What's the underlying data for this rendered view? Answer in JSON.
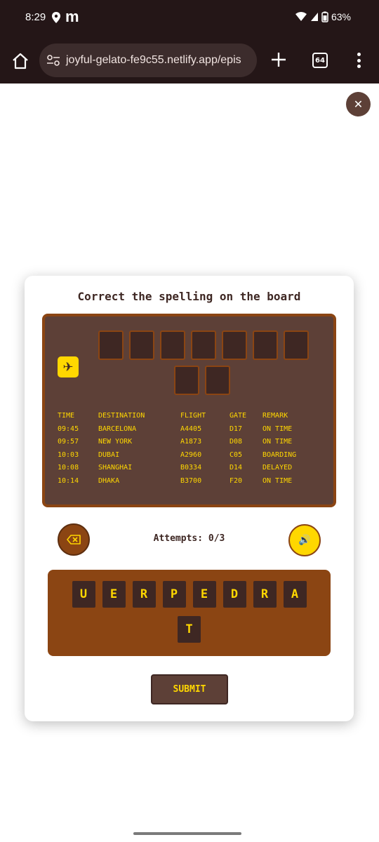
{
  "status_bar": {
    "time": "8:29",
    "battery": "63%"
  },
  "browser": {
    "url": "joyful-gelato-fe9c55.netlify.app/epis",
    "tab_count": "64"
  },
  "close_symbol": "✕",
  "game": {
    "title": "Correct the spelling on the board",
    "plane_symbol": "✈",
    "attempts": "Attempts: 0/3",
    "submit_label": "SUBMIT",
    "sound_symbol": "🔊",
    "answer_slots_row1": 7,
    "answer_slots_row2": 2,
    "flight_board": {
      "headers": [
        "TIME",
        "DESTINATION",
        "FLIGHT",
        "GATE",
        "REMARK"
      ],
      "rows": [
        [
          "09:45",
          "BARCELONA",
          "A4405",
          "D17",
          "ON TIME"
        ],
        [
          "09:57",
          "NEW YORK",
          "A1873",
          "D08",
          "ON TIME"
        ],
        [
          "10:03",
          "DUBAI",
          "A2960",
          "C05",
          "BOARDING"
        ],
        [
          "10:08",
          "SHANGHAI",
          "B0334",
          "D14",
          "DELAYED"
        ],
        [
          "10:14",
          "DHAKA",
          "B3700",
          "F20",
          "ON TIME"
        ]
      ]
    },
    "letter_tiles": [
      "U",
      "E",
      "R",
      "P",
      "E",
      "D",
      "R",
      "A",
      "T"
    ]
  },
  "colors": {
    "dark_brown": "#3e2723",
    "medium_brown": "#5d4037",
    "saddle_brown": "#8b4513",
    "gold": "#ffd700",
    "status_bg": "#241617"
  }
}
